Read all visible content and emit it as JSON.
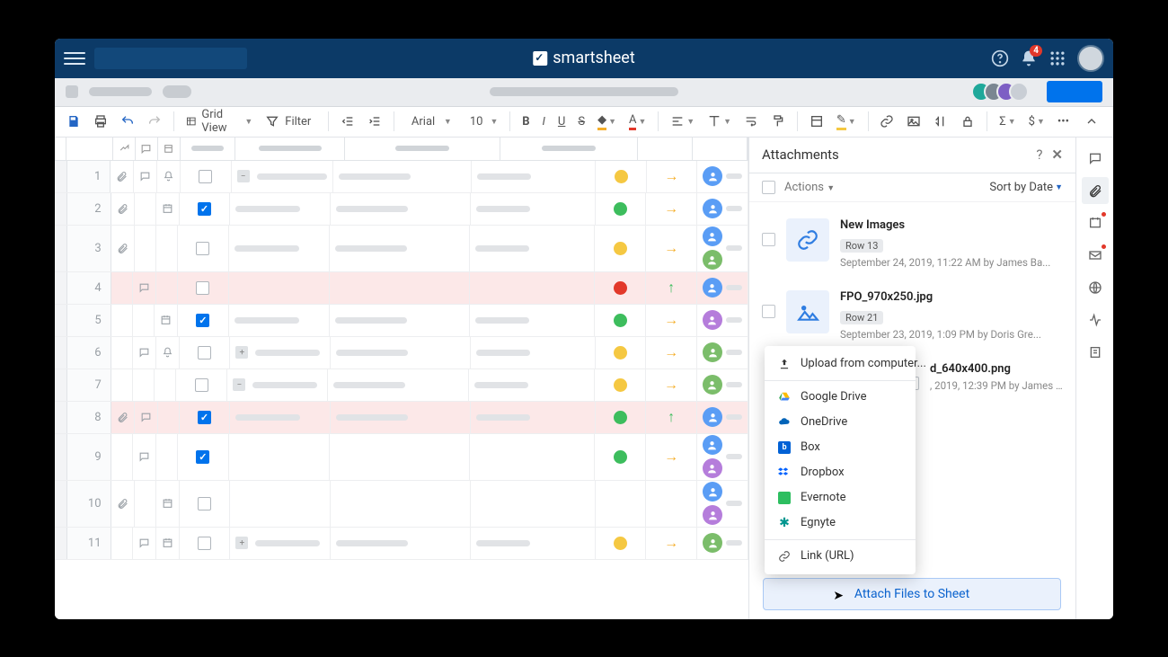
{
  "brand": "smartsheet",
  "notification_count": "4",
  "toolbar": {
    "view_label": "Grid View",
    "filter_label": "Filter",
    "font_name": "Arial",
    "font_size": "10"
  },
  "collab_colors": [
    "#1fa89a",
    "#7a8691",
    "#7d5fc4",
    "#c9ced5"
  ],
  "columns": {
    "placeholder_widths": [
      36,
      70,
      60
    ]
  },
  "rows": [
    {
      "n": "1",
      "attach": true,
      "comment": true,
      "reminder": false,
      "automation": false,
      "bell": true,
      "checked": false,
      "expand": "minus",
      "col1": 130,
      "col2": 80,
      "col3": 60,
      "status": "yellow",
      "arrow": "right",
      "persons": [
        "blue"
      ],
      "pink": false,
      "tall": false
    },
    {
      "n": "2",
      "attach": true,
      "comment": false,
      "reminder": true,
      "automation": false,
      "bell": false,
      "checked": true,
      "expand": "",
      "col1": 120,
      "col2": 80,
      "col3": 60,
      "status": "green",
      "arrow": "right",
      "persons": [
        "blue"
      ],
      "pink": false,
      "tall": false
    },
    {
      "n": "3",
      "attach": true,
      "comment": false,
      "reminder": false,
      "automation": false,
      "bell": false,
      "checked": false,
      "expand": "",
      "col1": 120,
      "col2": 80,
      "col3": 60,
      "status": "yellow",
      "arrow": "right",
      "persons": [
        "blue",
        "green"
      ],
      "pink": false,
      "tall": true
    },
    {
      "n": "4",
      "attach": false,
      "comment": true,
      "reminder": false,
      "automation": false,
      "bell": false,
      "checked": false,
      "expand": "",
      "col1": 0,
      "col2": 0,
      "col3": 0,
      "status": "red",
      "arrow": "up",
      "persons": [
        "blue"
      ],
      "pink": true,
      "tall": false
    },
    {
      "n": "5",
      "attach": false,
      "comment": false,
      "reminder": true,
      "automation": false,
      "bell": false,
      "checked": true,
      "expand": "",
      "col1": 120,
      "col2": 80,
      "col3": 60,
      "status": "green",
      "arrow": "right",
      "persons": [
        "purple"
      ],
      "pink": false,
      "tall": false
    },
    {
      "n": "6",
      "attach": false,
      "comment": true,
      "reminder": false,
      "automation": false,
      "bell": true,
      "checked": false,
      "expand": "plus",
      "col1": 120,
      "col2": 80,
      "col3": 60,
      "status": "yellow",
      "arrow": "right",
      "persons": [
        "green"
      ],
      "pink": false,
      "tall": false
    },
    {
      "n": "7",
      "attach": false,
      "comment": false,
      "reminder": false,
      "automation": false,
      "bell": false,
      "checked": false,
      "expand": "minus",
      "col1": 120,
      "col2": 80,
      "col3": 60,
      "status": "yellow",
      "arrow": "right",
      "persons": [
        "green"
      ],
      "pink": false,
      "tall": false
    },
    {
      "n": "8",
      "attach": true,
      "comment": true,
      "reminder": false,
      "automation": false,
      "bell": false,
      "checked": true,
      "expand": "",
      "col1": 120,
      "col2": 80,
      "col3": 60,
      "status": "green",
      "arrow": "up",
      "persons": [
        "blue"
      ],
      "pink": true,
      "tall": false
    },
    {
      "n": "9",
      "attach": false,
      "comment": true,
      "reminder": false,
      "automation": false,
      "bell": false,
      "checked": true,
      "expand": "",
      "col1": 0,
      "col2": 0,
      "col3": 0,
      "status": "green",
      "arrow": "right",
      "persons": [
        "blue",
        "purple"
      ],
      "pink": false,
      "tall": true
    },
    {
      "n": "10",
      "attach": true,
      "comment": false,
      "reminder": true,
      "automation": false,
      "bell": false,
      "checked": false,
      "expand": "",
      "col1": 0,
      "col2": 0,
      "col3": 0,
      "status": "",
      "arrow": "",
      "persons": [
        "blue",
        "purple"
      ],
      "pink": false,
      "tall": true
    },
    {
      "n": "11",
      "attach": false,
      "comment": true,
      "reminder": true,
      "automation": false,
      "bell": true,
      "checked": false,
      "expand": "plus",
      "col1": 120,
      "col2": 80,
      "col3": 60,
      "status": "yellow",
      "arrow": "right",
      "persons": [
        "green"
      ],
      "pink": false,
      "tall": false
    }
  ],
  "attachments_panel": {
    "title": "Attachments",
    "actions_label": "Actions",
    "sort_label": "Sort by Date",
    "items": [
      {
        "title": "New Images",
        "row_badge": "Row 13",
        "sub": "September 24, 2019, 11:22 AM by James Ba...",
        "thumb": "link"
      },
      {
        "title": "FPO_970x250.jpg",
        "row_badge": "Row 21",
        "sub": "September 23, 2019, 1:09 PM by Doris Gre...",
        "thumb": "image"
      },
      {
        "title": "d_640x400.png",
        "row_badge": "",
        "sub": ", 2019, 12:39 PM by James Ba...",
        "thumb": "image",
        "obscured": true
      }
    ]
  },
  "upload_menu": {
    "items": [
      {
        "label": "Upload from computer...",
        "icon": "upload",
        "color": "#333"
      },
      {
        "label": "Google Drive",
        "icon": "gdrive",
        "color": "#34a853"
      },
      {
        "label": "OneDrive",
        "icon": "onedrive",
        "color": "#0364b8"
      },
      {
        "label": "Box",
        "icon": "box",
        "color": "#0061d5"
      },
      {
        "label": "Dropbox",
        "icon": "dropbox",
        "color": "#0061fe"
      },
      {
        "label": "Evernote",
        "icon": "evernote",
        "color": "#2dbe60"
      },
      {
        "label": "Egnyte",
        "icon": "egnyte",
        "color": "#00968f"
      }
    ],
    "link_label": "Link (URL)"
  },
  "attach_button": "Attach Files to Sheet"
}
